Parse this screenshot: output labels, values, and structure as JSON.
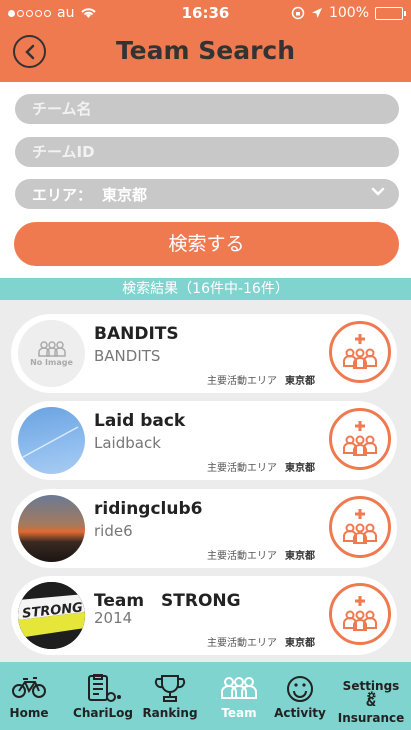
{
  "status_bar": {
    "carrier": "au",
    "time": "16:36",
    "battery": "100%"
  },
  "header": {
    "title": "Team Search"
  },
  "form": {
    "team_name_placeholder": "チーム名",
    "team_id_placeholder": "チームID",
    "area_label": "エリア：",
    "area_value": "東京都",
    "search_label": "検索する"
  },
  "results": {
    "summary": "検索結果（16件中-16件）"
  },
  "teams": [
    {
      "name": "BANDITS",
      "sub": "BANDITS",
      "area_label": "主要活動エリア",
      "area": "東京都",
      "image": "No Image"
    },
    {
      "name": "Laid back",
      "sub": "Laidback",
      "area_label": "主要活動エリア",
      "area": "東京都"
    },
    {
      "name": "ridingclub6",
      "sub": "ride6",
      "area_label": "主要活動エリア",
      "area": "東京都"
    },
    {
      "name": "Team　STRONG",
      "sub": "2014",
      "area_label": "主要活動エリア",
      "area": "東京都",
      "image_text": "STRONG"
    }
  ],
  "tabs": [
    {
      "label": "Home",
      "icon": "bicycle-icon"
    },
    {
      "label": "ChariLog",
      "icon": "clipboard-bike-icon"
    },
    {
      "label": "Ranking",
      "icon": "trophy-icon"
    },
    {
      "label": "Team",
      "icon": "group-icon"
    },
    {
      "label": "Activity",
      "icon": "smiley-icon"
    },
    {
      "label": "Settings\n&\nInsurance",
      "label_line1": "Settings",
      "label_line2": "&",
      "label_line3": "Insurance",
      "icon": "gear-icon"
    }
  ],
  "colors": {
    "accent": "#f07a50",
    "teal": "#7fd4cf",
    "field": "#c8c8c8"
  }
}
